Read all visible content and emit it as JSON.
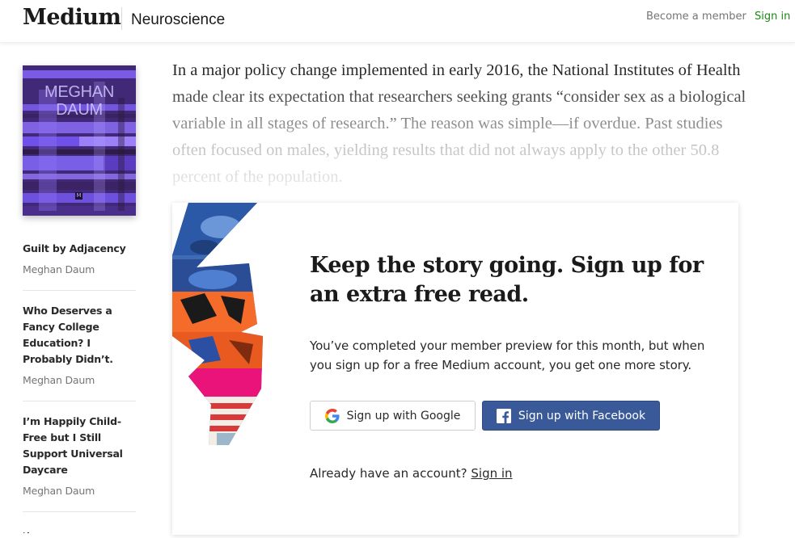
{
  "header": {
    "logo": "Medium",
    "publication": "Neuroscience",
    "become_member": "Become a member",
    "sign_in": "Sign in"
  },
  "sidebar": {
    "cover": {
      "author_line1": "MEGHAN",
      "author_line2": "DAUM",
      "badge": "M",
      "colors": {
        "purple": "#7b5cf0",
        "dark": "#2a1838"
      }
    },
    "articles": [
      {
        "title": "Guilt by Adjacency",
        "author": "Meghan Daum"
      },
      {
        "title": "Who Deserves a Fancy College Education? I Probably Didn’t.",
        "author": "Meghan Daum"
      },
      {
        "title": "I’m Happily Child-Free but I Still Support Universal Daycare",
        "author": "Meghan Daum"
      }
    ],
    "next_cut": "N"
  },
  "article": {
    "text": "In a major policy change implemented in early 2016, the National Institutes of Health made clear its expectation that researchers seeking grants “consider sex as a biological variable in all stages of research.” The reason was simple—if overdue. Past studies often focused on males, yielding results that did not always apply to the other 50.8 percent of the population."
  },
  "paywall": {
    "heading": "Keep the story going. Sign up for an extra free read.",
    "body": "You’ve completed your member preview for this month, but when you sign up for a free Medium account, you get one more story.",
    "google_button": "Sign up with Google",
    "facebook_button": "Sign up with Facebook",
    "already_text": "Already have an account?",
    "sign_in_link": "Sign in",
    "icons": {
      "google": "google-g-icon",
      "facebook": "facebook-f-icon"
    },
    "colors": {
      "facebook": "#3a5998",
      "accent_green": "#1a8917"
    }
  }
}
